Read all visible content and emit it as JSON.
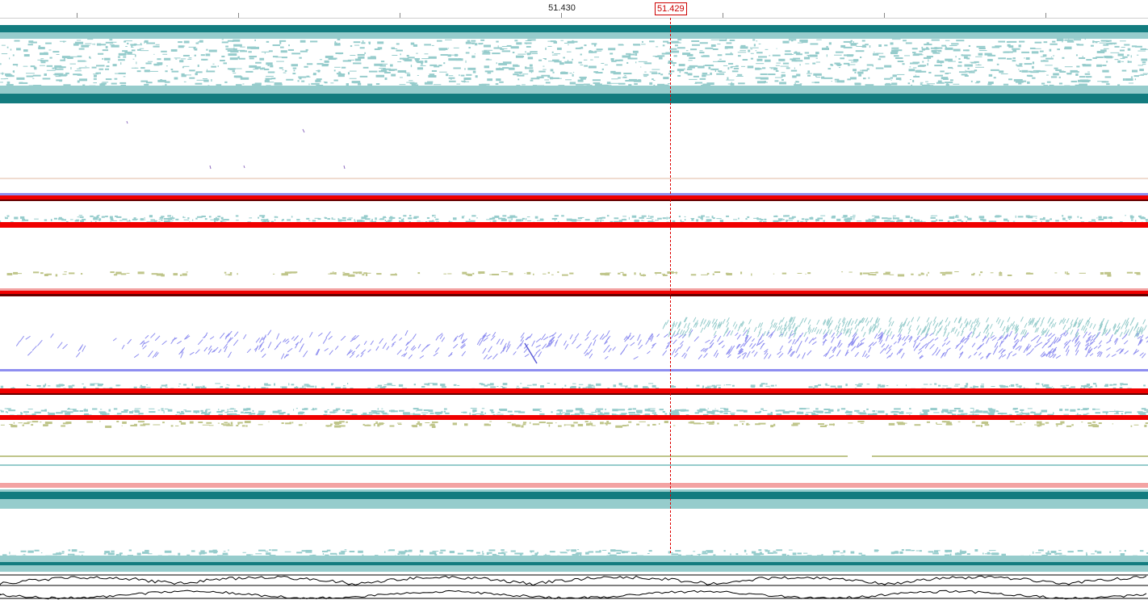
{
  "ruler": {
    "tick_label": "51.430",
    "cursor_label": "51.429"
  },
  "colors": {
    "teal_dark": "#137c7f",
    "teal_light": "#96cccc",
    "red": "#f00000",
    "pink": "#f3a3a3",
    "lavender": "#8e8ef0",
    "olive": "#bfc58a",
    "cursor": "#dd0000"
  },
  "tracks": [
    {
      "name": "alignment-track-top"
    },
    {
      "name": "sparse-track"
    },
    {
      "name": "red-track-a"
    },
    {
      "name": "red-track-b"
    },
    {
      "name": "variant-track"
    },
    {
      "name": "red-track-c"
    },
    {
      "name": "red-track-d"
    },
    {
      "name": "alignment-track-bottom"
    },
    {
      "name": "signal-track"
    }
  ]
}
